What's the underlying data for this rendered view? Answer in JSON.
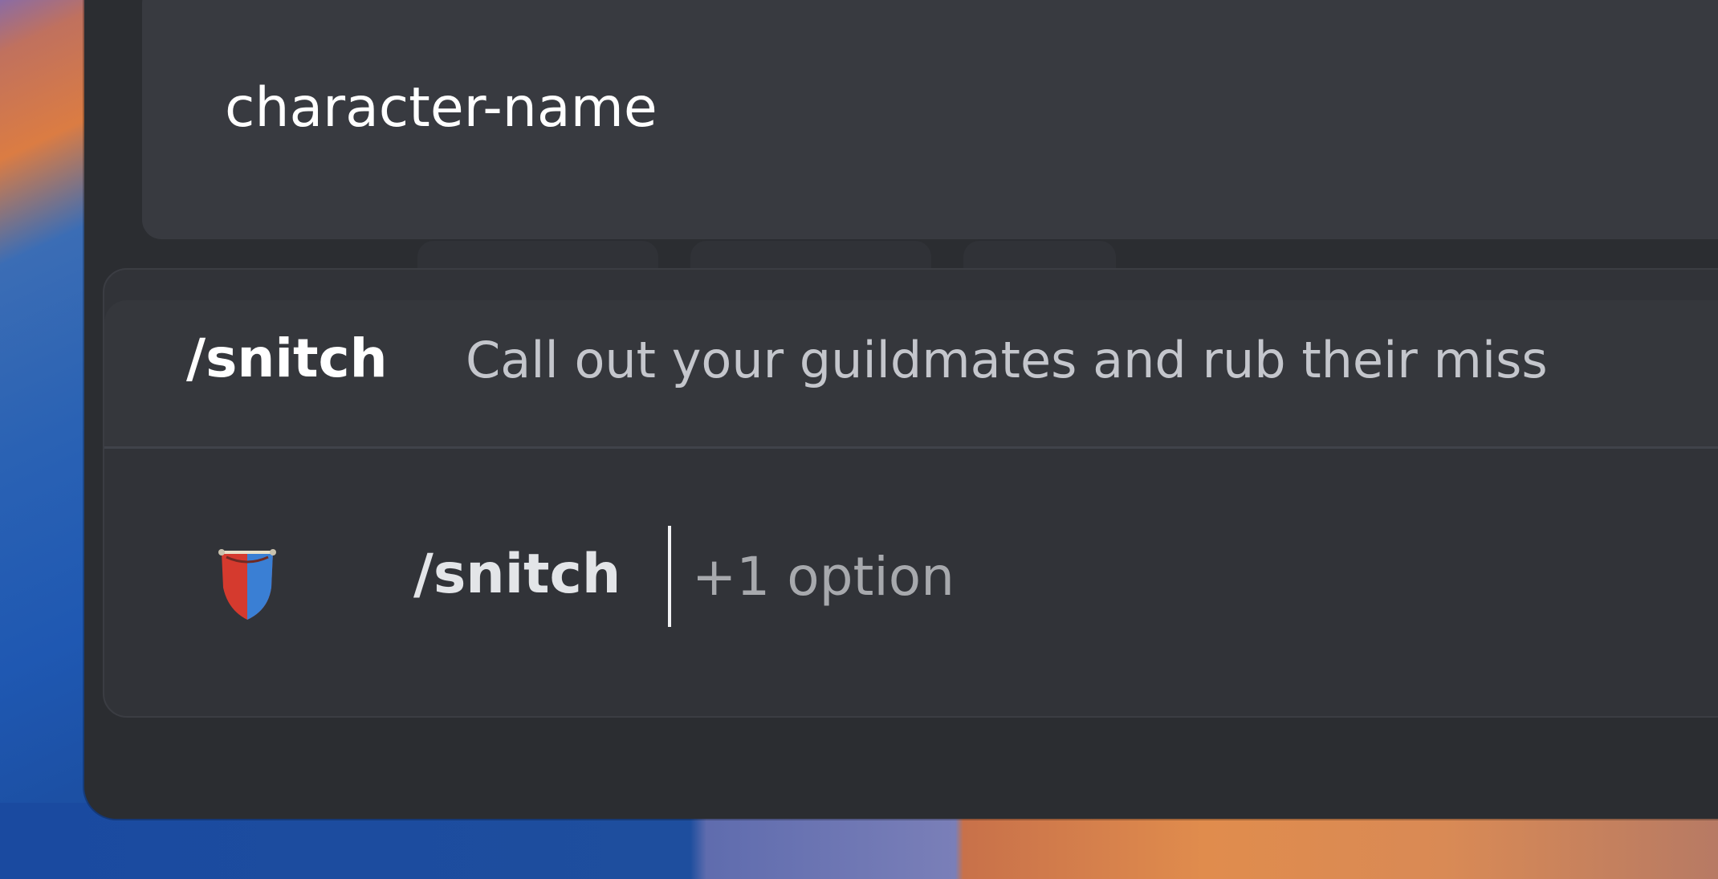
{
  "channel": {
    "name_value": "character-name"
  },
  "autocomplete": {
    "command_name": "/snitch",
    "command_description": "Call out your guildmates and rub their miss"
  },
  "input": {
    "command_text": "/snitch",
    "options_hint": "+1 option",
    "bot_icon": "shield-banner-icon"
  },
  "colors": {
    "window_bg": "#2b2d31",
    "field_bg": "#383a40",
    "panel_bg": "#313338",
    "highlight_row_bg": "#35373c",
    "text_primary": "#ffffff",
    "text_muted": "#a7a9ad"
  }
}
